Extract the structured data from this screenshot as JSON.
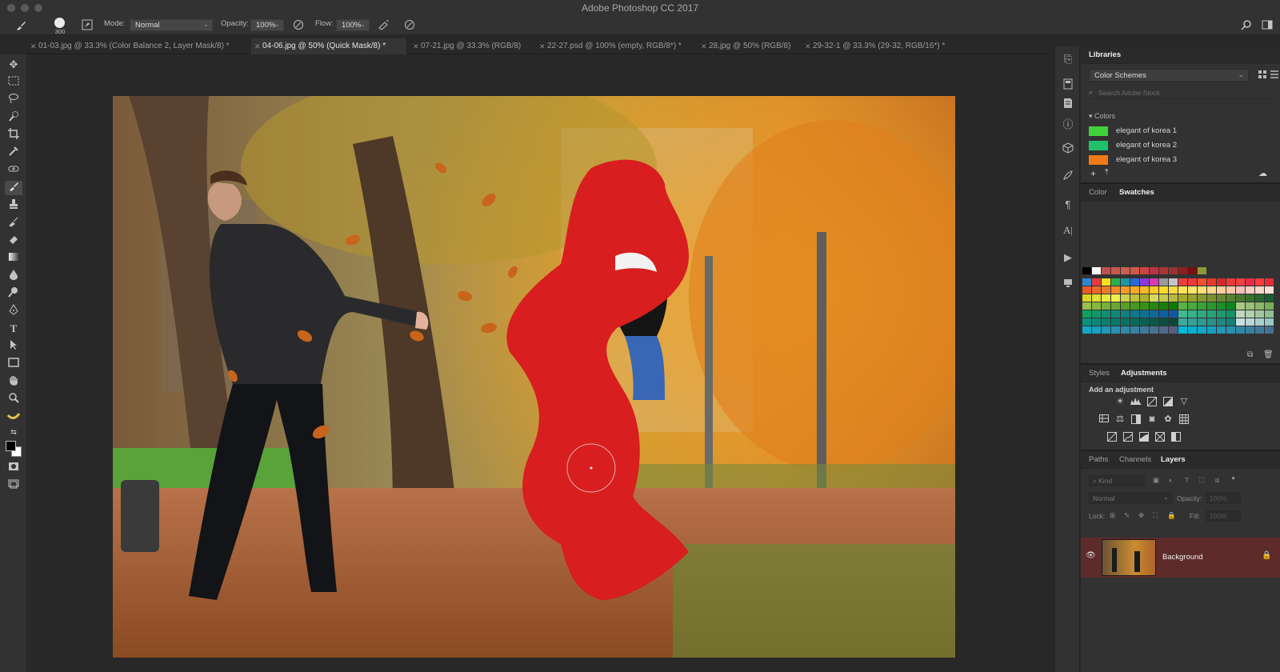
{
  "window": {
    "title": "Adobe Photoshop CC 2017"
  },
  "options_bar": {
    "brush_size": "300",
    "mode_label": "Mode:",
    "mode_value": "Normal",
    "opacity_label": "Opacity:",
    "opacity_value": "100%",
    "flow_label": "Flow:",
    "flow_value": "100%"
  },
  "tabs": [
    {
      "label": "01-03.jpg @ 33.3% (Color Balance 2, Layer Mask/8) *",
      "active": false
    },
    {
      "label": "04-06.jpg @ 50% (Quick Mask/8) *",
      "active": true
    },
    {
      "label": "07-21.jpg @ 33.3% (RGB/8)",
      "active": false
    },
    {
      "label": "22-27.psd @ 100% (empty, RGB/8*) *",
      "active": false
    },
    {
      "label": "28.jpg @ 50% (RGB/8)",
      "active": false
    },
    {
      "label": "29-32-1 @ 33.3% (29-32, RGB/16*) *",
      "active": false
    }
  ],
  "libraries": {
    "tab": "Libraries",
    "dropdown": "Color Schemes",
    "search_placeholder": "Search Adobe Stock",
    "section": "Colors",
    "colors": [
      {
        "name": "elegant of korea 1",
        "hex": "#3fd23a"
      },
      {
        "name": "elegant of korea 2",
        "hex": "#1fc16b"
      },
      {
        "name": "elegant of korea 3",
        "hex": "#f07a16"
      }
    ]
  },
  "color_panel": {
    "tab_color": "Color",
    "tab_swatches": "Swatches"
  },
  "adjustments_panel": {
    "tab_styles": "Styles",
    "tab_adjustments": "Adjustments",
    "heading": "Add an adjustment"
  },
  "layers_panel": {
    "tab_paths": "Paths",
    "tab_channels": "Channels",
    "tab_layers": "Layers",
    "kind_label": "Kind",
    "blend_mode": "Normal",
    "opacity_label": "Opacity:",
    "opacity_value": "100%",
    "lock_label": "Lock:",
    "fill_label": "Fill:",
    "fill_value": "100%",
    "layers": [
      {
        "name": "Background",
        "locked": true,
        "visible": true
      }
    ]
  },
  "colors": {
    "mask_red": "#d81e1e",
    "ui_dark": "#282828",
    "panel": "#323232",
    "layer_selected": "#5e2b2b"
  }
}
